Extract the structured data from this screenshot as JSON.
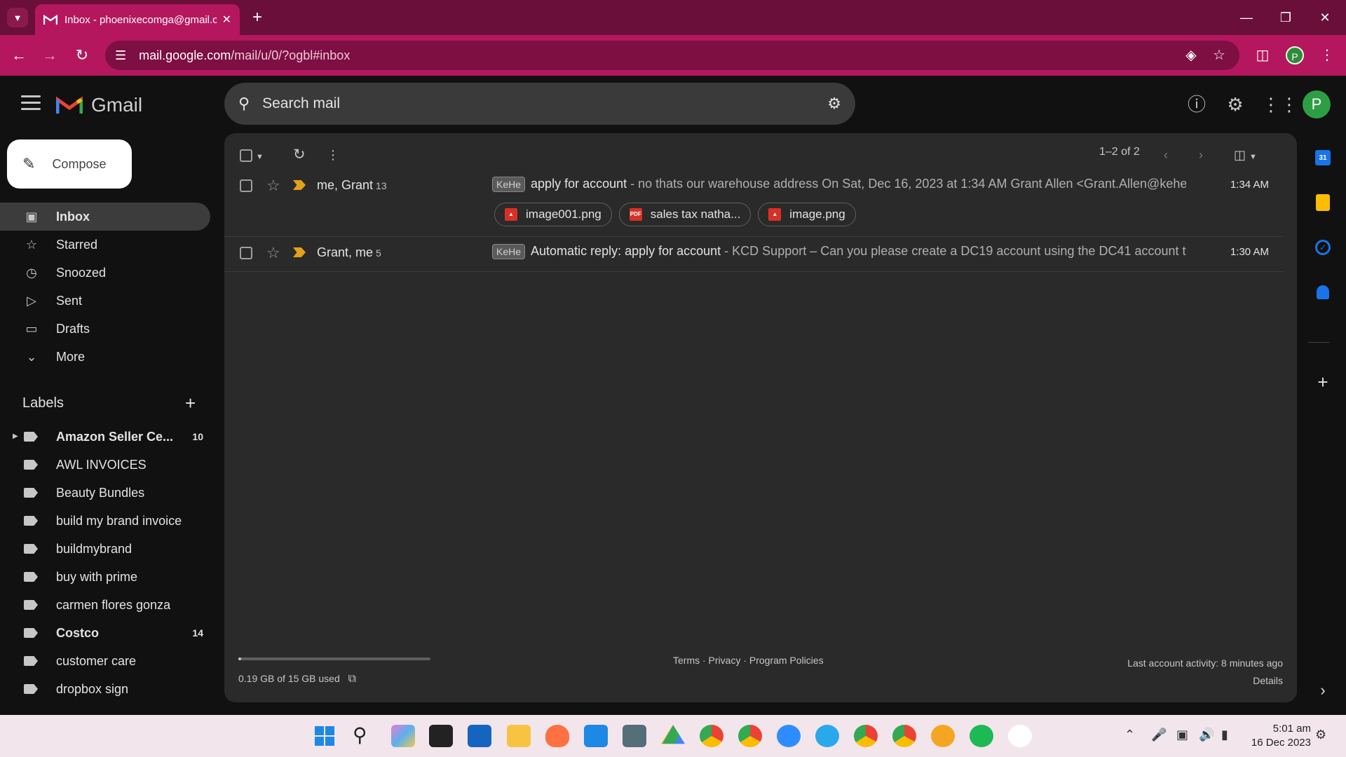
{
  "browser": {
    "tab_title": "Inbox - phoenixecomga@gmail.com",
    "url_host": "mail.google.com",
    "url_path": "/mail/u/0/?ogbl#inbox",
    "profile_initial": "P"
  },
  "app": {
    "name": "Gmail",
    "search_placeholder": "Search mail",
    "avatar_initial": "P"
  },
  "compose_label": "Compose",
  "nav": [
    {
      "label": "Inbox",
      "icon": "inbox-icon",
      "active": true
    },
    {
      "label": "Starred",
      "icon": "star-icon"
    },
    {
      "label": "Snoozed",
      "icon": "clock-icon"
    },
    {
      "label": "Sent",
      "icon": "send-icon"
    },
    {
      "label": "Drafts",
      "icon": "file-icon"
    },
    {
      "label": "More",
      "icon": "chevron-down-icon"
    }
  ],
  "labels": {
    "heading": "Labels",
    "items": [
      {
        "name": "Amazon Seller Ce...",
        "count": "10",
        "bold": true
      },
      {
        "name": "AWL INVOICES",
        "count": ""
      },
      {
        "name": "Beauty Bundles",
        "count": ""
      },
      {
        "name": "build my brand invoice",
        "count": ""
      },
      {
        "name": "buildmybrand",
        "count": ""
      },
      {
        "name": "buy with prime",
        "count": ""
      },
      {
        "name": "carmen flores gonza",
        "count": ""
      },
      {
        "name": "Costco",
        "count": "14",
        "bold": true
      },
      {
        "name": "customer care",
        "count": ""
      },
      {
        "name": "dropbox sign",
        "count": ""
      }
    ]
  },
  "list": {
    "pager": "1–2 of 2",
    "rows": [
      {
        "sender": "me, Grant",
        "count": "13",
        "tag": "KeHe",
        "subject": "apply for account",
        "snippet": " - no thats our warehouse address On Sat, Dec 16, 2023 at 1:34 AM Grant Allen <Grant.Allen@kehe....",
        "time": "1:34 AM",
        "attachments": [
          {
            "name": "image001.png",
            "type": "image"
          },
          {
            "name": "sales tax natha...",
            "type": "pdf"
          },
          {
            "name": "image.png",
            "type": "image"
          }
        ]
      },
      {
        "sender": "Grant, me",
        "count": "5",
        "tag": "KeHe",
        "subject": "Automatic reply: apply for account",
        "snippet": " - KCD Support – Can you please create a DC19 account using the DC41 account t...",
        "time": "1:30 AM",
        "attachments": []
      }
    ]
  },
  "footer": {
    "storage": "0.19 GB of 15 GB used",
    "storage_fraction": 0.013,
    "links": "Terms · Privacy · Program Policies",
    "activity": "Last account activity: 8 minutes ago",
    "details": "Details"
  },
  "taskbar": {
    "time": "5:01 am",
    "date": "16 Dec 2023"
  }
}
